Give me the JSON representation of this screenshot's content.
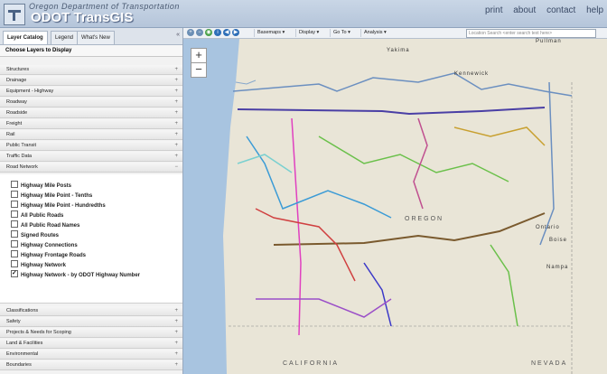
{
  "header": {
    "dept": "Oregon Department of Transportation",
    "title": "ODOT TransGIS",
    "links": [
      "print",
      "about",
      "contact",
      "help"
    ]
  },
  "tabs": [
    {
      "label": "Layer Catalog",
      "active": true
    },
    {
      "label": "Legend",
      "active": false
    },
    {
      "label": "What's New",
      "active": false
    }
  ],
  "sidebar": {
    "choose_label": "Choose Layers to Display",
    "categories_top": [
      "Structures",
      "Drainage",
      "Equipment - Highway",
      "Roadway",
      "Roadside",
      "Freight",
      "Rail",
      "Public Transit",
      "Traffic Data",
      "Road Network"
    ],
    "layers": [
      {
        "label": "Highway Mile Posts",
        "checked": false
      },
      {
        "label": "Highway Mile Point - Tenths",
        "checked": false
      },
      {
        "label": "Highway Mile Point - Hundredths",
        "checked": false
      },
      {
        "label": "All Public Roads",
        "checked": false
      },
      {
        "label": "All Public Road Names",
        "checked": false
      },
      {
        "label": "Signed Routes",
        "checked": false
      },
      {
        "label": "Highway Connections",
        "checked": false
      },
      {
        "label": "Highway Frontage Roads",
        "checked": false
      },
      {
        "label": "Highway Network",
        "checked": false
      },
      {
        "label": "Highway Network - by ODOT Highway Number",
        "checked": true
      }
    ],
    "categories_bottom": [
      "Classifications",
      "Safety",
      "Projects & Needs for Scoping",
      "Land & Facilities",
      "Environmental",
      "Boundaries"
    ]
  },
  "toolbar": {
    "menus": [
      "Basemaps ▾",
      "Display ▾",
      "Go To ▾",
      "Analysis ▾"
    ],
    "search_placeholder": "Location Search  <enter search text here>"
  },
  "map": {
    "cities": [
      "Yakima",
      "Kennewick",
      "Pullman",
      "Boise",
      "Nampa",
      "Ontario"
    ],
    "states": [
      "OREGON",
      "CALIFORNIA",
      "NEVADA"
    ],
    "zoom_in": "+",
    "zoom_out": "−"
  },
  "colors": {
    "water": "#a8c4e0",
    "land": "#e9e5d7",
    "header": "#b5c5da"
  }
}
